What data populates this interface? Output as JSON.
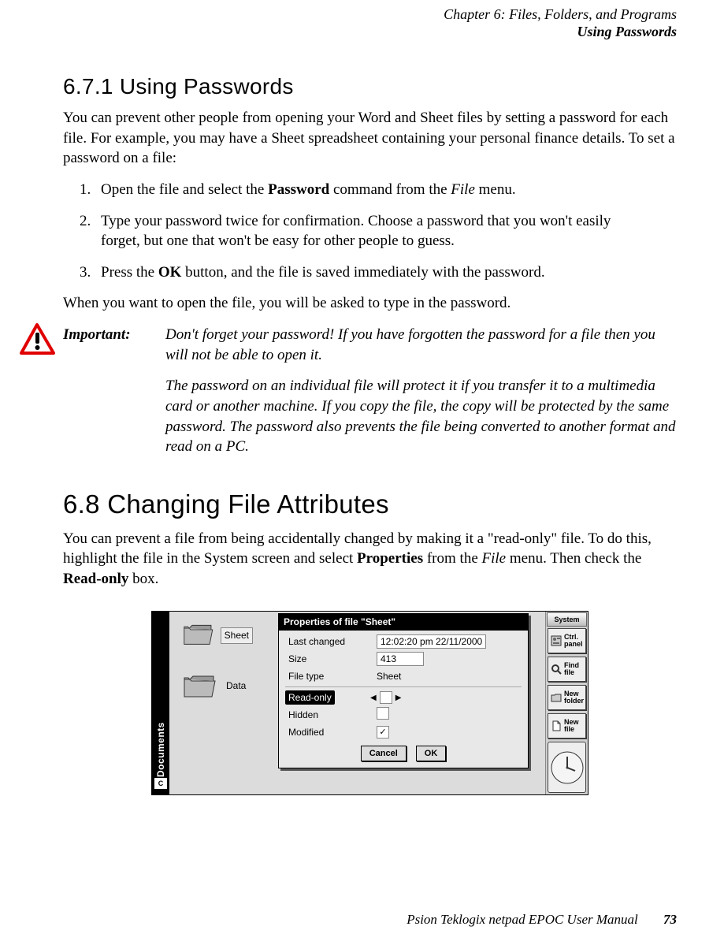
{
  "header": {
    "chapter": "Chapter 6:  Files, Folders, and Programs",
    "section": "Using Passwords"
  },
  "s671": {
    "heading": "6.7.1  Using Passwords",
    "intro": "You can prevent other people from opening your Word and Sheet files by setting a password for each file. For example, you may have a Sheet spreadsheet containing your personal finance details. To set a password on a file:",
    "steps": {
      "s1_a": "Open the file and select the ",
      "s1_b": "Password",
      "s1_c": " command from the ",
      "s1_d": "File",
      "s1_e": " menu.",
      "s2": "Type your password twice for confirmation. Choose a password that you won't easily forget, but one that won't be easy for other people to guess.",
      "s3_a": "Press the ",
      "s3_b": "OK",
      "s3_c": " button, and the file is saved immediately with the password."
    },
    "after": "When you want to open the file, you will be asked to type in the password.",
    "important": {
      "label": "Important:",
      "p1": "Don't forget your password! If you have forgotten the password for a file then you will not be able to open it.",
      "p2": "The password on an individual file will protect it if you transfer it to a multimedia card or another machine. If you copy the file, the copy will be protected by the same password. The password also prevents the file being converted to another format and read on a PC."
    }
  },
  "s68": {
    "heading": "6.8  Changing File Attributes",
    "p_a": "You can prevent a file from being accidentally changed by making it a \"read-only\" file. To do this, highlight the file in the System screen and select ",
    "p_b": "Properties",
    "p_c": " from the ",
    "p_d": "File",
    "p_e": " menu. Then check the ",
    "p_f": "Read-only",
    "p_g": " box."
  },
  "figure": {
    "leftbar": {
      "label": "Documents",
      "drive": "C"
    },
    "desktop_icons": [
      {
        "label": "Sheet"
      },
      {
        "label": "Data"
      }
    ],
    "dialog": {
      "title": "Properties of file \"Sheet\"",
      "rows": {
        "last_changed": {
          "label": "Last changed",
          "value": "12:02:20 pm 22/11/2000"
        },
        "size": {
          "label": "Size",
          "value": "413"
        },
        "file_type": {
          "label": "File type",
          "value": "Sheet"
        },
        "read_only": {
          "label": "Read-only",
          "checked": false
        },
        "hidden": {
          "label": "Hidden",
          "checked": false
        },
        "modified": {
          "label": "Modified",
          "checked": true
        }
      },
      "buttons": {
        "cancel": "Cancel",
        "ok": "OK"
      }
    },
    "sidebar": {
      "tab": "System",
      "buttons": [
        {
          "label": "Ctrl. panel"
        },
        {
          "label": "Find file"
        },
        {
          "label": "New folder"
        },
        {
          "label": "New file"
        }
      ]
    }
  },
  "footer": {
    "text": "Psion Teklogix netpad EPOC User Manual",
    "page": "73"
  }
}
